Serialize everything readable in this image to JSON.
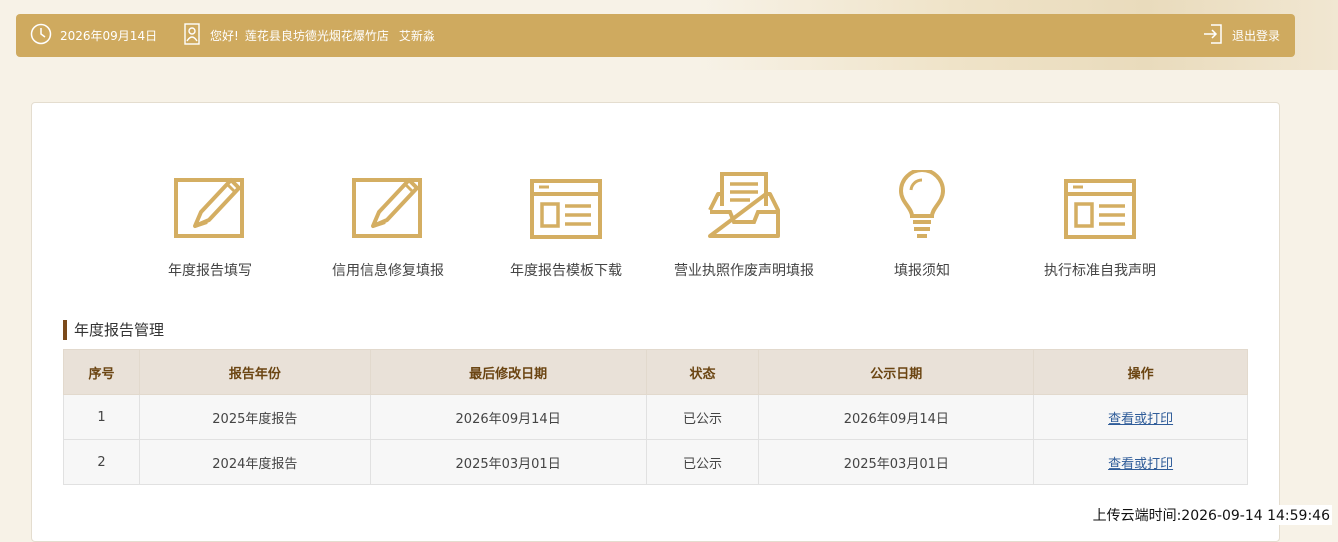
{
  "header": {
    "date": "2026年09月14日",
    "greeting": "您好!",
    "company": "莲花县良坊德光烟花爆竹店",
    "user": "艾新淼",
    "logout_label": "退出登录"
  },
  "menu": [
    {
      "label": "年度报告填写",
      "icon": "edit-icon"
    },
    {
      "label": "信用信息修复填报",
      "icon": "edit-icon"
    },
    {
      "label": "年度报告模板下载",
      "icon": "template-icon"
    },
    {
      "label": "营业执照作废声明填报",
      "icon": "inbox-document-icon"
    },
    {
      "label": "填报须知",
      "icon": "lightbulb-icon"
    },
    {
      "label": "执行标准自我声明",
      "icon": "template-icon"
    }
  ],
  "section": {
    "title": "年度报告管理"
  },
  "table": {
    "headers": [
      "序号",
      "报告年份",
      "最后修改日期",
      "状态",
      "公示日期",
      "操作"
    ],
    "rows": [
      {
        "no": "1",
        "year": "2025年度报告",
        "modified": "2026年09月14日",
        "status": "已公示",
        "published": "2026年09月14日",
        "action": "查看或打印"
      },
      {
        "no": "2",
        "year": "2024年度报告",
        "modified": "2025年03月01日",
        "status": "已公示",
        "published": "2025年03月01日",
        "action": "查看或打印"
      }
    ]
  },
  "upload_time": "上传云端时间:2026-09-14 14:59:46",
  "colors": {
    "accent": "#cfaa5f",
    "icon": "#d4ae62",
    "link": "#2f5c99",
    "title_bar": "#7b4a1b"
  }
}
